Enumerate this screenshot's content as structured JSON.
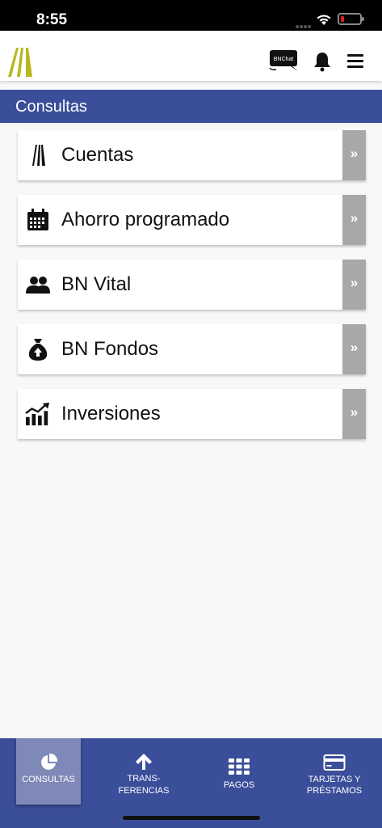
{
  "status_bar": {
    "time": "8:55"
  },
  "header": {
    "logo_icon": "bn-logo-icon",
    "chat_icon": "bnchat-icon",
    "chat_label": "BNChat",
    "notifications_icon": "bell-icon",
    "menu_icon": "hamburger-menu-icon"
  },
  "section": {
    "title": "Consultas"
  },
  "items": [
    {
      "label": "Cuentas",
      "icon": "accounts-logo-icon",
      "arrow": "»"
    },
    {
      "label": "Ahorro programado",
      "icon": "calendar-icon",
      "arrow": "»"
    },
    {
      "label": "BN Vital",
      "icon": "users-icon",
      "arrow": "»"
    },
    {
      "label": "BN Fondos",
      "icon": "money-bag-icon",
      "arrow": "»"
    },
    {
      "label": "Inversiones",
      "icon": "growth-chart-icon",
      "arrow": "»"
    }
  ],
  "bottom_nav": [
    {
      "label": "CONSULTAS",
      "icon": "pie-chart-icon",
      "active": true
    },
    {
      "label_line1": "TRANS-",
      "label_line2": "FERENCIAS",
      "icon": "arrow-up-icon"
    },
    {
      "label": "PAGOS",
      "icon": "grid-icon"
    },
    {
      "label_line1": "TARJETAS Y",
      "label_line2": "PRÉSTAMOS",
      "icon": "credit-card-icon"
    }
  ],
  "colors": {
    "primary": "#3b4e9a",
    "active_tab": "#7f89b8",
    "logo": "#b8b81e",
    "arrow_bg": "#a8a8a8"
  }
}
